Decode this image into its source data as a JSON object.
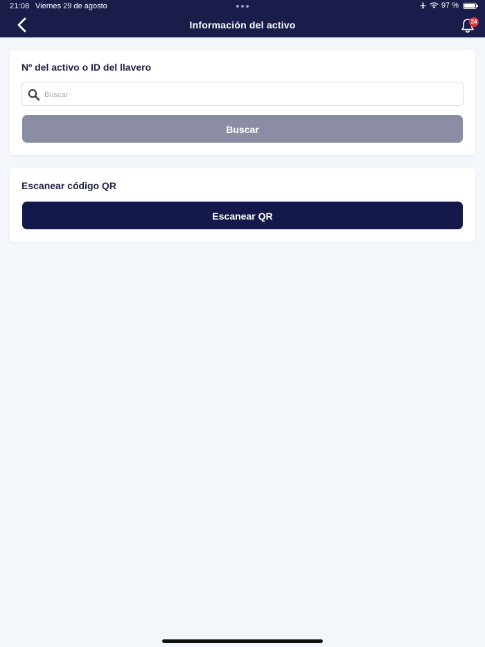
{
  "status_bar": {
    "time": "21:08",
    "date": "Viernes 29 de agosto",
    "battery": "97 %",
    "battery_level": 0.97
  },
  "nav": {
    "title": "Información del activo",
    "back_icon": "chevron-left-icon",
    "bell_icon": "bell-icon",
    "notification_count": "24"
  },
  "search_card": {
    "title": "Nº del activo o ID del llavero",
    "input_placeholder": "Buscar",
    "input_value": "",
    "button_label": "Buscar"
  },
  "qr_card": {
    "title": "Escanear código QR",
    "button_label": "Escanear QR"
  },
  "colors": {
    "header_bg": "#1a1d4a",
    "page_bg": "#f3f6fa",
    "primary_button": "#15184a",
    "disabled_button": "#8a8da3",
    "badge": "#e0303a"
  }
}
